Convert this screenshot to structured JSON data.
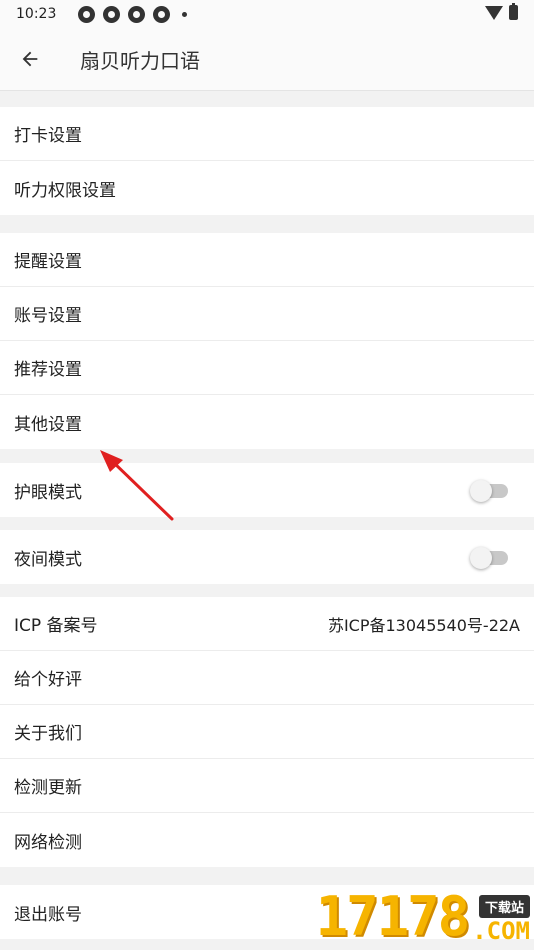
{
  "status_bar": {
    "time": "10:23"
  },
  "app_bar": {
    "title": "扇贝听力口语"
  },
  "groups": [
    {
      "items": [
        {
          "label": "打卡设置"
        },
        {
          "label": "听力权限设置"
        }
      ]
    },
    {
      "items": [
        {
          "label": "提醒设置"
        },
        {
          "label": "账号设置"
        },
        {
          "label": "推荐设置"
        },
        {
          "label": "其他设置"
        }
      ]
    },
    {
      "items": [
        {
          "label": "护眼模式",
          "toggle": false
        }
      ]
    },
    {
      "items": [
        {
          "label": "夜间模式",
          "toggle": false
        }
      ]
    },
    {
      "items": [
        {
          "label": "ICP 备案号",
          "value": "苏ICP备13045540号-22A"
        },
        {
          "label": "给个好评"
        },
        {
          "label": "关于我们"
        },
        {
          "label": "检测更新"
        },
        {
          "label": "网络检测"
        }
      ]
    },
    {
      "items": [
        {
          "label": "退出账号"
        }
      ]
    }
  ],
  "watermark": {
    "number": "17178",
    "tag": "下载站",
    "domain": ".COM"
  },
  "colors": {
    "annotation_arrow": "#e02020",
    "watermark": "#f6b400"
  }
}
